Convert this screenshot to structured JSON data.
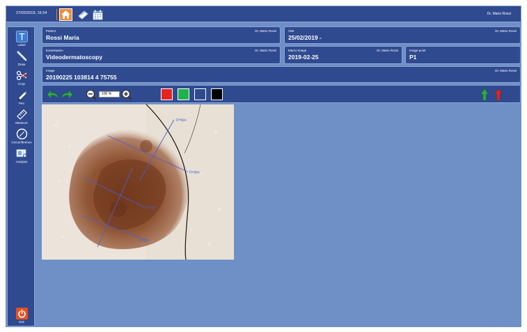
{
  "header": {
    "datetime": "27/02/2019, 16:24",
    "user": "Dr. Mario Rossi",
    "icons": [
      "home-icon",
      "book-icon",
      "calendar-icon"
    ]
  },
  "sidebar": {
    "tools": [
      {
        "name": "label",
        "label": "Label",
        "icon": "text-t-icon"
      },
      {
        "name": "draw",
        "label": "Draw",
        "icon": "pen-draw-icon"
      },
      {
        "name": "crop",
        "label": "Crop",
        "icon": "scissors-icon"
      },
      {
        "name": "pen",
        "label": "Pen",
        "icon": "pen-icon"
      },
      {
        "name": "measure",
        "label": "Measure",
        "icon": "ruler-icon"
      },
      {
        "name": "circumference",
        "label": "Circumference",
        "icon": "circle-icon"
      },
      {
        "name": "analysis",
        "label": "Analysis",
        "icon": "analysis-icon"
      }
    ],
    "exit_label": "Exit"
  },
  "info": {
    "patient": {
      "label": "Patient",
      "value": "Rossi Maria",
      "user": "Dr. Mario Rossi"
    },
    "visit": {
      "label": "Visit",
      "value": "25/02/2019 -",
      "user": "Dr. Mario Rossi"
    },
    "examination": {
      "label": "Examination",
      "value": "Videodermatoscopy",
      "user": "Dr. Mario Rossi"
    },
    "macro_image": {
      "label": "Macro Image",
      "value": "2019-02-25",
      "user": "Dr. Mario Rossi"
    },
    "image_point": {
      "label": "Image point",
      "value": "P1"
    },
    "image": {
      "label": "Image",
      "value": "20190225 103814 4 75755",
      "user": "Dr. Mario Rossi"
    }
  },
  "toolbar": {
    "zoom_value": "100 %",
    "colors": [
      "#e52421",
      "#22b04a",
      "#2f4a8f",
      "#000000"
    ]
  },
  "measurements": [
    "D=6px",
    "D=3px",
    "D=7px",
    "D=2px"
  ],
  "colors": {
    "panel": "#2f4a8f",
    "background": "#6f90c6",
    "accent": "#f28b33",
    "annotation": "#4a5fd0"
  }
}
